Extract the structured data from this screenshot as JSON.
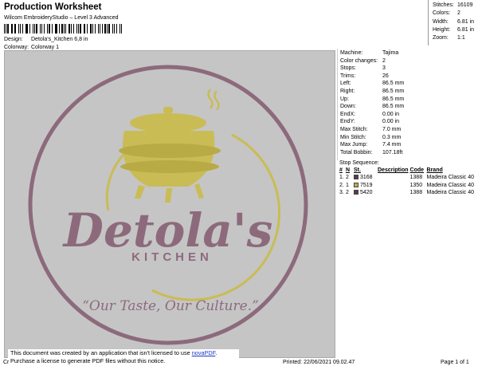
{
  "header": {
    "title": "Production Worksheet",
    "software": "Wilcom EmbroideryStudio – Level 3 Advanced",
    "design_label": "Design:",
    "design_value": "Detola's_Kitchen 6,8 in",
    "colorway_label": "Colorway:",
    "colorway_value": "Colorway 1"
  },
  "summary": [
    {
      "label": "Stitches:",
      "value": "16109"
    },
    {
      "label": "Colors:",
      "value": "2"
    },
    {
      "label": "Width:",
      "value": "6.81 in"
    },
    {
      "label": "Height:",
      "value": "6.81 in"
    },
    {
      "label": "Zoom:",
      "value": "1:1"
    }
  ],
  "machine": [
    {
      "label": "Machine:",
      "value": "Tajima"
    },
    {
      "label": "Color changes:",
      "value": "2"
    },
    {
      "label": "Stops:",
      "value": "3"
    },
    {
      "label": "Trims:",
      "value": "26"
    },
    {
      "label": "Left:",
      "value": "86.5 mm"
    },
    {
      "label": "Right:",
      "value": "86.5 mm"
    },
    {
      "label": "Up:",
      "value": "86.5 mm"
    },
    {
      "label": "Down:",
      "value": "86.5 mm"
    },
    {
      "label": "EndX:",
      "value": "0.00 in"
    },
    {
      "label": "EndY:",
      "value": "0.00 in"
    },
    {
      "label": "Max Stitch:",
      "value": "7.0 mm"
    },
    {
      "label": "Min Stitch:",
      "value": "0.3 mm"
    },
    {
      "label": "Max Jump:",
      "value": "7.4 mm"
    },
    {
      "label": "Total Bobbin:",
      "value": "107.18ft"
    }
  ],
  "stop_sequence": {
    "title": "Stop Sequence:",
    "columns": [
      "#",
      "N",
      "St.",
      "Description",
      "Code",
      "Brand"
    ],
    "rows": [
      {
        "num": "1.",
        "n": "2",
        "color": "#5c3a4c",
        "st": "3168",
        "description": "",
        "code": "1388",
        "brand": "Madeira Classic 40"
      },
      {
        "num": "2.",
        "n": "1",
        "color": "#bdb04a",
        "st": "7519",
        "description": "",
        "code": "1350",
        "brand": "Madeira Classic 40"
      },
      {
        "num": "3.",
        "n": "2",
        "color": "#5c3a4c",
        "st": "5420",
        "description": "",
        "code": "1388",
        "brand": "Madeira Classic 40"
      }
    ]
  },
  "artwork": {
    "wordmark": "Detola's",
    "subword": "KITCHEN",
    "tagline": "“Our Taste, Our Culture.”",
    "colors": {
      "thread_dark": "#8c6a7c",
      "thread_gold": "#c9bc55",
      "fabric": "#c5c5c5"
    }
  },
  "footer": {
    "notice_line1_pre": "This document was created by an application that isn't licensed to use ",
    "notice_link": "novaPDF",
    "notice_line1_post": ".",
    "notice_line2": "Purchase a license to generate PDF files without this notice.",
    "left_mark": "Cr",
    "printed": "Printed: 22/06/2021 09.02.47",
    "page": "Page 1 of 1"
  }
}
